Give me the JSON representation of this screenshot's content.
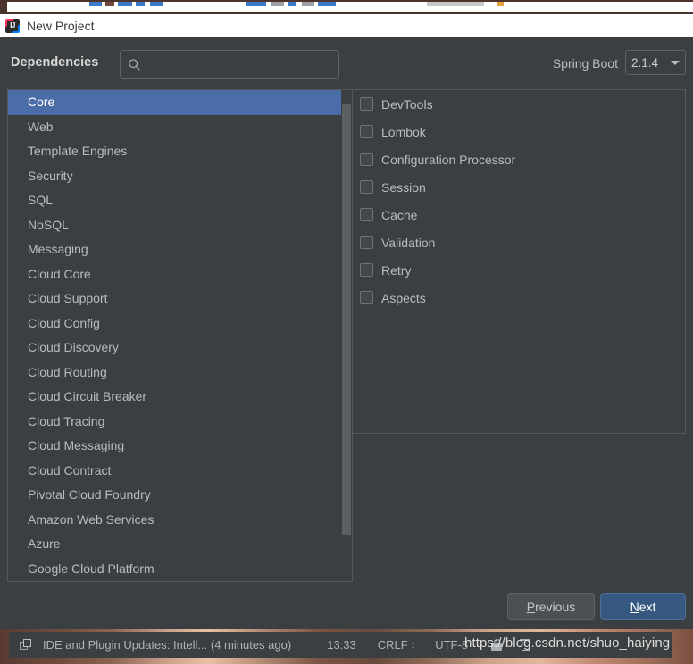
{
  "window": {
    "title": "New Project",
    "app_icon": "intellij-idea-icon"
  },
  "header": {
    "dependencies_label": "Dependencies",
    "search_placeholder": "",
    "search_value": "",
    "search_icon": "search-icon",
    "spring_boot_label": "Spring Boot",
    "spring_boot_version": "2.1.4",
    "dropdown_icon": "chevron-down-icon"
  },
  "categories": [
    {
      "label": "Core",
      "selected": true
    },
    {
      "label": "Web",
      "selected": false
    },
    {
      "label": "Template Engines",
      "selected": false
    },
    {
      "label": "Security",
      "selected": false
    },
    {
      "label": "SQL",
      "selected": false
    },
    {
      "label": "NoSQL",
      "selected": false
    },
    {
      "label": "Messaging",
      "selected": false
    },
    {
      "label": "Cloud Core",
      "selected": false
    },
    {
      "label": "Cloud Support",
      "selected": false
    },
    {
      "label": "Cloud Config",
      "selected": false
    },
    {
      "label": "Cloud Discovery",
      "selected": false
    },
    {
      "label": "Cloud Routing",
      "selected": false
    },
    {
      "label": "Cloud Circuit Breaker",
      "selected": false
    },
    {
      "label": "Cloud Tracing",
      "selected": false
    },
    {
      "label": "Cloud Messaging",
      "selected": false
    },
    {
      "label": "Cloud Contract",
      "selected": false
    },
    {
      "label": "Pivotal Cloud Foundry",
      "selected": false
    },
    {
      "label": "Amazon Web Services",
      "selected": false
    },
    {
      "label": "Azure",
      "selected": false
    },
    {
      "label": "Google Cloud Platform",
      "selected": false
    }
  ],
  "dependencies": [
    {
      "label": "DevTools",
      "checked": false
    },
    {
      "label": "Lombok",
      "checked": false
    },
    {
      "label": "Configuration Processor",
      "checked": false
    },
    {
      "label": "Session",
      "checked": false
    },
    {
      "label": "Cache",
      "checked": false
    },
    {
      "label": "Validation",
      "checked": false
    },
    {
      "label": "Retry",
      "checked": false
    },
    {
      "label": "Aspects",
      "checked": false
    }
  ],
  "detail_panel": {
    "text": ""
  },
  "footer": {
    "previous": {
      "before": "",
      "mnemonic": "P",
      "after": "revious"
    },
    "next": {
      "before": "",
      "mnemonic": "N",
      "after": "ext"
    }
  },
  "statusbar": {
    "windows_icon": "windows-layers-icon",
    "message": "IDE and Plugin Updates: Intell... (4 minutes ago)",
    "time": "13:33",
    "line_separator": "CRLF",
    "line_separator_arrows": "↕",
    "encoding": "UTF-8",
    "lock_icon": "lock-icon",
    "trash_icon": "trash-icon"
  },
  "watermark": {
    "text": "https://blog.csdn.net/shuo_haiying"
  },
  "colors": {
    "dialog_bg": "#3c3f41",
    "selection_blue": "#4a6da7",
    "primary_button": "#365880",
    "titlebar_bg": "#ffffff",
    "text": "#b8bcbf"
  }
}
